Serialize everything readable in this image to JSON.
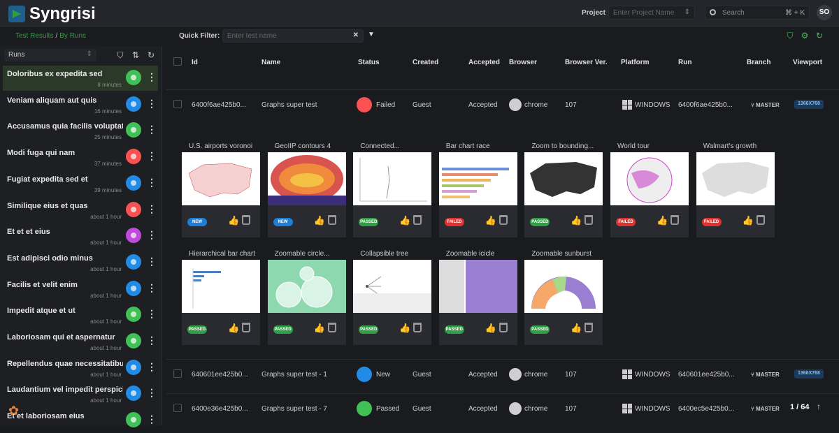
{
  "app": {
    "name": "Syngrisi",
    "avatar": "SO"
  },
  "header": {
    "project_label": "Project",
    "project_placeholder": "Enter Project Name",
    "search_placeholder": "Search",
    "search_kbd": "⌘ + K"
  },
  "breadcrumb": {
    "test_results": "Test Results",
    "separator": "/",
    "by_runs": "By Runs"
  },
  "quick_filter": {
    "label": "Quick Filter:",
    "placeholder": "Enter test name"
  },
  "sidebar": {
    "runs_label": "Runs",
    "runs": [
      {
        "name": "Doloribus ex expedita sed",
        "time": "8 minutes",
        "color": "#40c057",
        "active": true
      },
      {
        "name": "Veniam aliquam aut quis",
        "time": "16 minutes",
        "color": "#228be6"
      },
      {
        "name": "Accusamus quia facilis voluptat...",
        "time": "25 minutes",
        "color": "#40c057"
      },
      {
        "name": "Modi fuga qui nam",
        "time": "37 minutes",
        "color": "#fa5252"
      },
      {
        "name": "Fugiat expedita sed et",
        "time": "39 minutes",
        "color": "#228be6"
      },
      {
        "name": "Similique eius et quas",
        "time": "about 1 hour",
        "color": "#fa5252"
      },
      {
        "name": "Et et et eius",
        "time": "about 1 hour",
        "color": "#be4bdb"
      },
      {
        "name": "Est adipisci odio minus",
        "time": "about 1 hour",
        "color": "#228be6"
      },
      {
        "name": "Facilis et velit enim",
        "time": "about 1 hour",
        "color": "#228be6"
      },
      {
        "name": "Impedit atque et ut",
        "time": "about 1 hour",
        "color": "#40c057"
      },
      {
        "name": "Laboriosam qui et aspernatur",
        "time": "about 1 hour",
        "color": "#40c057"
      },
      {
        "name": "Repellendus quae necessitatibu...",
        "time": "about 1 hour",
        "color": "#228be6"
      },
      {
        "name": "Laudantium vel impedit perspici...",
        "time": "about 1 hour",
        "color": "#228be6"
      },
      {
        "name": "Et et laboriosam eius",
        "time": "",
        "color": "#40c057"
      }
    ]
  },
  "table": {
    "headers": [
      "Id",
      "Name",
      "Status",
      "Created",
      "Accepted",
      "Browser",
      "Browser Ver.",
      "Platform",
      "Run",
      "Branch",
      "Viewport"
    ],
    "rows": [
      {
        "id": "6400f6ae425b0...",
        "name": "Graphs super test",
        "status": "Failed",
        "created": "Guest",
        "accepted": "Accepted",
        "browser": "chrome",
        "ver": "107",
        "platform": "WINDOWS",
        "run": "6400f6ae425b0...",
        "branch": "MASTER",
        "viewport": "1366X768",
        "status_color": "#fa5252"
      },
      {
        "id": "640601ee425b0...",
        "name": "Graphs super test - 1",
        "status": "New",
        "created": "Guest",
        "accepted": "Accepted",
        "browser": "chrome",
        "ver": "107",
        "platform": "WINDOWS",
        "run": "640601ee425b0...",
        "branch": "MASTER",
        "viewport": "1366X768",
        "status_color": "#228be6"
      },
      {
        "id": "6400e36e425b0...",
        "name": "Graphs super test - 7",
        "status": "Passed",
        "created": "Guest",
        "accepted": "Accepted",
        "browser": "chrome",
        "ver": "107",
        "platform": "WINDOWS",
        "run": "6400ec5e425b0...",
        "branch": "MASTER",
        "viewport": "",
        "status_color": "#40c057"
      }
    ]
  },
  "snapshots": [
    {
      "title": "U.S. airports voronoi",
      "badge": "NEW",
      "badge_color": "#1c7ed6",
      "thumb": "us-map"
    },
    {
      "title": "GeoIIP contours 4",
      "badge": "NEW",
      "badge_color": "#1c7ed6",
      "thumb": "heat"
    },
    {
      "title": "Connected...",
      "badge": "PASSED",
      "badge_color": "#2f9e44",
      "thumb": "scatter"
    },
    {
      "title": "Bar chart race",
      "badge": "FAILED",
      "badge_color": "#e03131",
      "thumb": "bars"
    },
    {
      "title": "Zoom to bounding...",
      "badge": "PASSED",
      "badge_color": "#2f9e44",
      "thumb": "dark-map"
    },
    {
      "title": "World tour",
      "badge": "FAILED",
      "badge_color": "#e03131",
      "thumb": "globe"
    },
    {
      "title": "Walmart's growth",
      "badge": "FAILED",
      "badge_color": "#e03131",
      "thumb": "gray-map"
    },
    {
      "title": "Hierarchical bar chart",
      "badge": "PASSED",
      "badge_color": "#2f9e44",
      "thumb": "hbar"
    },
    {
      "title": "Zoomable circle...",
      "badge": "PASSED",
      "badge_color": "#2f9e44",
      "thumb": "circles"
    },
    {
      "title": "Collapsible tree",
      "badge": "PASSED",
      "badge_color": "#2f9e44",
      "thumb": "tree"
    },
    {
      "title": "Zoomable icicle",
      "badge": "PASSED",
      "badge_color": "#2f9e44",
      "thumb": "icicle"
    },
    {
      "title": "Zoomable sunburst",
      "badge": "PASSED",
      "badge_color": "#2f9e44",
      "thumb": "sunburst"
    }
  ],
  "pagination": {
    "counter": "1 / 64"
  }
}
